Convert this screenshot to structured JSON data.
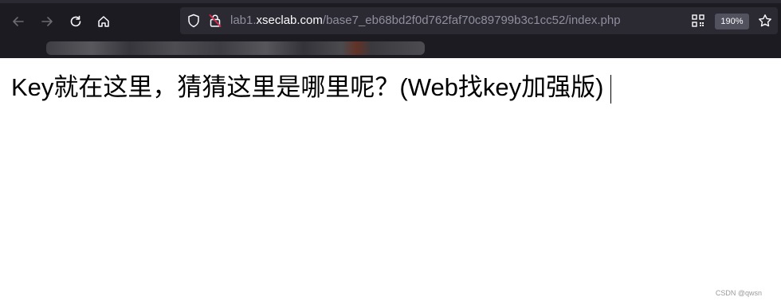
{
  "browser": {
    "back_icon": "arrow-left-icon",
    "forward_icon": "arrow-right-icon",
    "reload_icon": "reload-icon",
    "home_icon": "home-icon",
    "url_prefix": "lab1.",
    "url_domain": "xseclab.com",
    "url_path": "/base7_eb68bd2f0d762faf70c89799b3c1cc52/index.php",
    "zoom_level": "190%",
    "colors": {
      "toolbar_bg": "#1c1b22",
      "urlbar_bg": "#2b2a33",
      "url_text": "#8f8f9d",
      "url_domain_text": "#fbfbfe"
    }
  },
  "page": {
    "heading": "Key就在这里，猜猜这里是哪里呢？(Web找key加强版)"
  },
  "watermark": "CSDN @qwsn"
}
